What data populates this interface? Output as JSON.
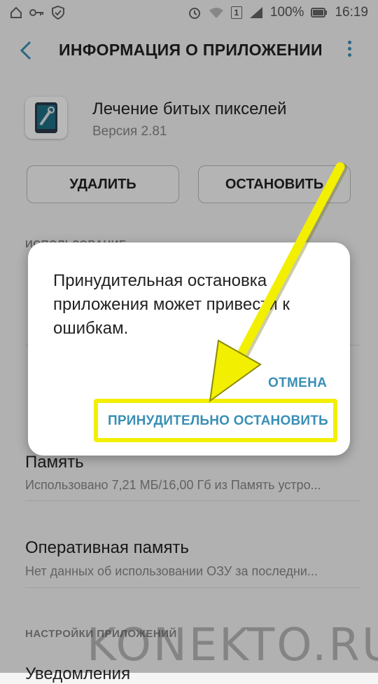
{
  "status_bar": {
    "battery": "100%",
    "time": "16:19",
    "sim": "1"
  },
  "app_bar": {
    "title": "ИНФОРМАЦИЯ О ПРИЛОЖЕНИИ"
  },
  "app": {
    "name": "Лечение битых пикселей",
    "version": "Версия 2.81"
  },
  "buttons": {
    "delete": "УДАЛИТЬ",
    "stop": "ОСТАНОВИТЬ"
  },
  "sections": {
    "usage": "ИСПОЛЬЗОВАНИЕ",
    "app_settings": "НАСТРОЙКИ ПРИЛОЖЕНИЙ"
  },
  "rows": {
    "memory_title": "Память",
    "memory_sub": "Использовано 7,21 МБ/16,00 Гб из Память устро...",
    "ram_title": "Оперативная память",
    "ram_sub": "Нет данных об использовании ОЗУ за последни...",
    "notifications_title": "Уведомления"
  },
  "dialog": {
    "message": "Принудительная остановка приложения может привести к ошибкам.",
    "cancel": "ОТМЕНА",
    "force_stop": "ПРИНУДИТЕЛЬНО ОСТАНОВИТЬ"
  },
  "watermark": "KONEKTO.RU",
  "colors": {
    "accent": "#3a8fb5",
    "highlight": "#f3ef00"
  }
}
